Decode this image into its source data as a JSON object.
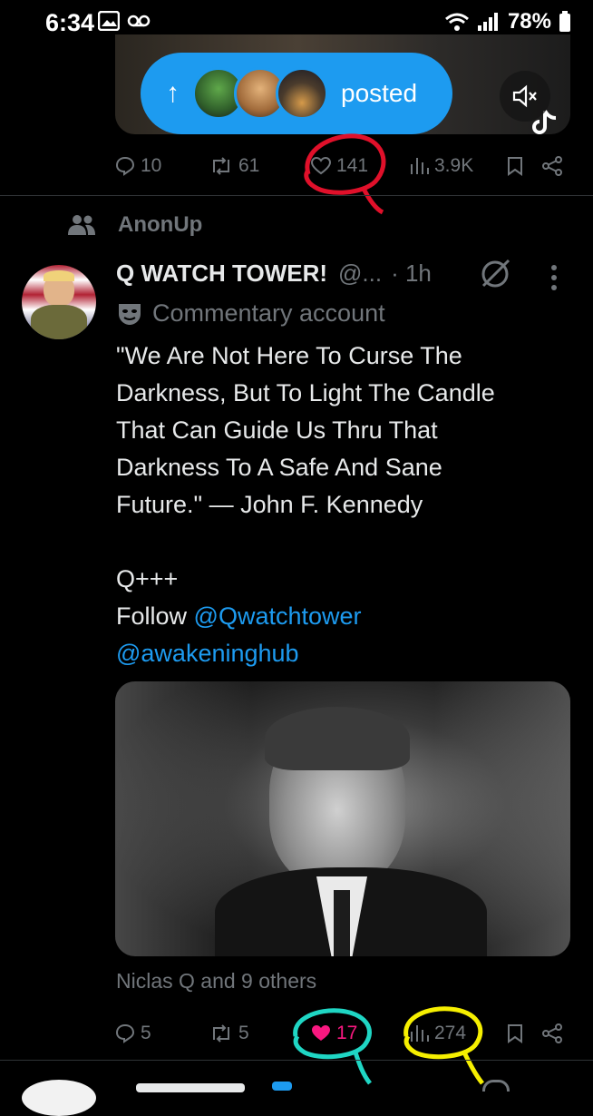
{
  "status_bar": {
    "time": "6:34",
    "battery": "78%"
  },
  "prev_post": {
    "pill_label": "posted",
    "actions": {
      "replies": "10",
      "reposts": "61",
      "likes": "141",
      "views": "3.9K"
    }
  },
  "tweet": {
    "repost_by": "AnonUp",
    "display_name": "Q WATCH TOWER!",
    "handle": "@...",
    "time": "· 1h",
    "label": "Commentary account",
    "text_lines": [
      "\"We Are Not Here To Curse The",
      "Darkness, But To Light The Candle",
      "That Can Guide Us Thru That",
      "Darkness To A Safe And Sane",
      "Future.\" — John F. Kennedy"
    ],
    "signoff": "Q+++",
    "follow_prefix": "Follow",
    "mention1": "@Qwatchtower",
    "mention2": "@awakeninghub",
    "liked_by": "Niclas Q and 9 others",
    "actions": {
      "replies": "5",
      "reposts": "5",
      "likes": "17",
      "views": "274"
    }
  },
  "colors": {
    "accent": "#1d9bf0",
    "like_active": "#f91880",
    "muted": "#71767b",
    "annot_red": "#e0102a",
    "annot_cyan": "#1fd6c4",
    "annot_yellow": "#f6ef00"
  }
}
